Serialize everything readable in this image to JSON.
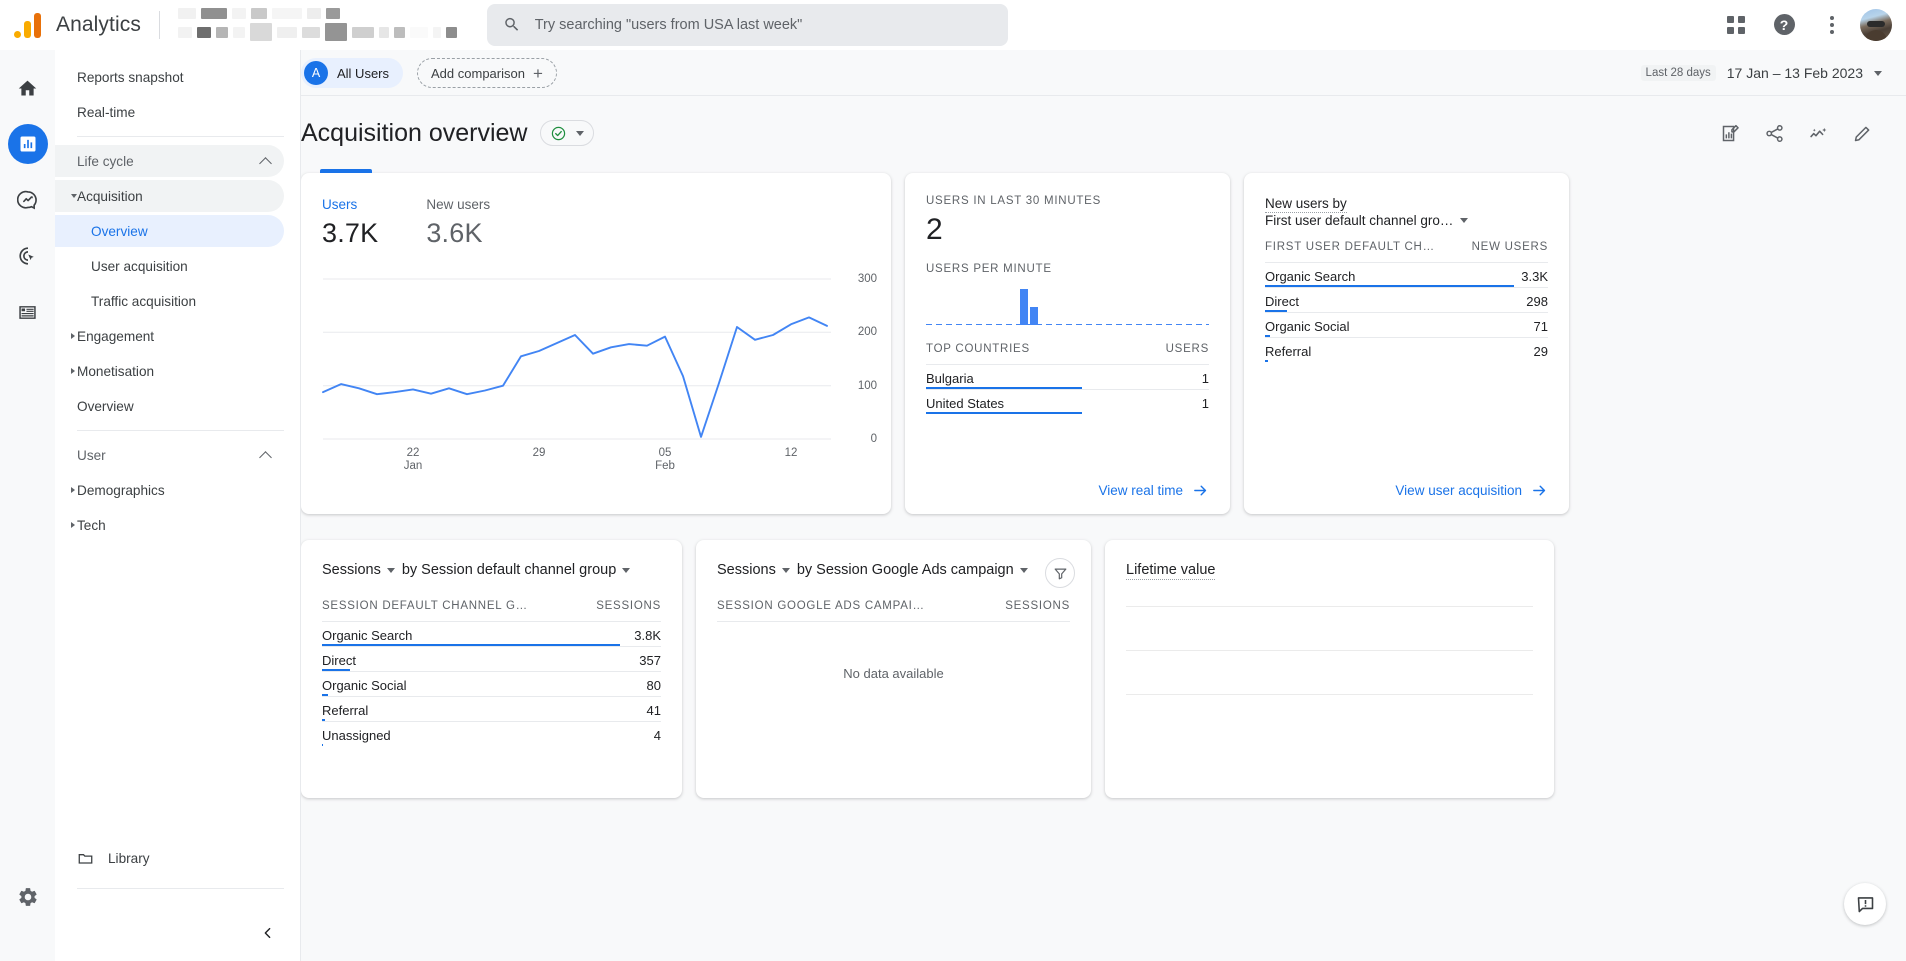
{
  "app": {
    "brand": "Analytics"
  },
  "search": {
    "placeholder": "Try searching \"users from USA last week\""
  },
  "topbar": {
    "apps_label": "Google apps",
    "help_label": "Help",
    "more_label": "More options",
    "account_label": "Account"
  },
  "rail": {
    "items": [
      {
        "name": "home",
        "label": "Home"
      },
      {
        "name": "reports",
        "label": "Reports"
      },
      {
        "name": "explore",
        "label": "Explore"
      },
      {
        "name": "advertising",
        "label": "Advertising"
      },
      {
        "name": "configure",
        "label": "Configure"
      }
    ],
    "settings_label": "Admin"
  },
  "sidebar": {
    "top_items": [
      {
        "label": "Reports snapshot"
      },
      {
        "label": "Real-time"
      }
    ],
    "groups": [
      {
        "label": "Life cycle",
        "items": [
          {
            "label": "Acquisition",
            "expanded": true,
            "highlight": true
          },
          {
            "label": "Overview",
            "sub": true,
            "selected": true
          },
          {
            "label": "User acquisition",
            "sub": true
          },
          {
            "label": "Traffic acquisition",
            "sub": true
          },
          {
            "label": "Engagement",
            "expanded": false
          },
          {
            "label": "Monetisation",
            "expanded": false
          },
          {
            "label": "Overview"
          }
        ]
      },
      {
        "label": "User",
        "items": [
          {
            "label": "Demographics",
            "expanded": false
          },
          {
            "label": "Tech",
            "expanded": false
          }
        ]
      }
    ],
    "library_label": "Library",
    "collapse_label": "Collapse navigation"
  },
  "subheader": {
    "all_users_initial": "A",
    "all_users_label": "All Users",
    "add_comparison_label": "Add comparison",
    "add_comparison_plus": "+",
    "date_badge": "Last 28 days",
    "date_range": "17 Jan – 13 Feb 2023"
  },
  "page": {
    "title": "Acquisition overview",
    "actions": [
      {
        "name": "insights-report-icon",
        "label": "Insights"
      },
      {
        "name": "share-icon",
        "label": "Share this report"
      },
      {
        "name": "sparkle-insights-icon",
        "label": "Insights"
      },
      {
        "name": "edit-pencil-icon",
        "label": "Customise report"
      }
    ]
  },
  "users_card": {
    "tabs": [
      {
        "label": "Users",
        "value": "3.7K",
        "active": true
      },
      {
        "label": "New users",
        "value": "3.6K",
        "active": false
      }
    ]
  },
  "realtime_card": {
    "users_label": "USERS IN LAST 30 MINUTES",
    "users_value": "2",
    "per_minute_label": "USERS PER MINUTE",
    "countries_header": "TOP COUNTRIES",
    "users_header": "USERS",
    "countries": [
      {
        "name": "Bulgaria",
        "value": "1",
        "pct": 100
      },
      {
        "name": "United States",
        "value": "1",
        "pct": 100
      }
    ],
    "footer_link": "View real time"
  },
  "newusers_card": {
    "title_prefix": "New users by",
    "dimension": "First user default channel gro…",
    "col_dimension": "FIRST USER DEFAULT CH…",
    "col_metric": "NEW USERS",
    "rows": [
      {
        "name": "Organic Search",
        "value": "3.3K",
        "pct": 100
      },
      {
        "name": "Direct",
        "value": "298",
        "pct": 9
      },
      {
        "name": "Organic Social",
        "value": "71",
        "pct": 2.2
      },
      {
        "name": "Referral",
        "value": "29",
        "pct": 1
      }
    ],
    "footer_link": "View user acquisition"
  },
  "sessions_channel_card": {
    "metric": "Sessions",
    "by_label": "by Session default channel group",
    "col_dimension": "SESSION DEFAULT CHANNEL G…",
    "col_metric": "SESSIONS",
    "rows": [
      {
        "name": "Organic Search",
        "value": "3.8K",
        "pct": 100
      },
      {
        "name": "Direct",
        "value": "357",
        "pct": 9.4
      },
      {
        "name": "Organic Social",
        "value": "80",
        "pct": 2.1
      },
      {
        "name": "Referral",
        "value": "41",
        "pct": 1.1
      },
      {
        "name": "Unassigned",
        "value": "4",
        "pct": 0.4
      }
    ]
  },
  "sessions_ads_card": {
    "metric": "Sessions",
    "by_label": "by Session Google Ads campaign",
    "col_dimension": "SESSION GOOGLE ADS CAMPAI…",
    "col_metric": "SESSIONS",
    "empty_message": "No data available",
    "filter_label": "Filter"
  },
  "lifetime_card": {
    "title": "Lifetime value"
  },
  "feedback": {
    "label": "Send feedback"
  },
  "colors": {
    "brand_blue": "#1a73e8",
    "chart_blue": "#4285f4",
    "accent_orange": "#f9ab00",
    "accent_orange_dark": "#e8710a",
    "check_green": "#1e8e3e",
    "text_primary": "#202124",
    "text_secondary": "#5f6368",
    "bg_canvas": "#f8f9fa"
  },
  "chart_data": {
    "type": "line",
    "title": "Users",
    "xlabel": "",
    "ylabel": "Users",
    "ylim": [
      0,
      300
    ],
    "yticks": [
      0,
      100,
      200,
      300
    ],
    "grid": true,
    "legend": "none",
    "x_tick_labels": [
      {
        "day": "22",
        "month": "Jan"
      },
      {
        "day": "29",
        "month": ""
      },
      {
        "day": "05",
        "month": "Feb"
      },
      {
        "day": "12",
        "month": ""
      }
    ],
    "x": [
      "17 Jan",
      "18 Jan",
      "19 Jan",
      "20 Jan",
      "21 Jan",
      "22 Jan",
      "23 Jan",
      "24 Jan",
      "25 Jan",
      "26 Jan",
      "27 Jan",
      "28 Jan",
      "29 Jan",
      "30 Jan",
      "31 Jan",
      "01 Feb",
      "02 Feb",
      "03 Feb",
      "04 Feb",
      "05 Feb",
      "06 Feb",
      "07 Feb",
      "08 Feb",
      "09 Feb",
      "10 Feb",
      "11 Feb",
      "12 Feb",
      "13 Feb"
    ],
    "series": [
      {
        "name": "Users",
        "color": "#4285f4",
        "values": [
          88,
          103,
          95,
          84,
          88,
          93,
          85,
          95,
          84,
          91,
          100,
          155,
          165,
          180,
          195,
          160,
          172,
          178,
          175,
          192,
          118,
          4,
          105,
          210,
          186,
          195,
          215,
          228,
          212
        ]
      }
    ]
  },
  "sparkline_data": {
    "type": "bar",
    "title": "Users per minute",
    "bins": 30,
    "values": [
      0,
      0,
      0,
      0,
      0,
      0,
      0,
      0,
      0,
      0,
      2,
      1,
      0,
      0,
      0,
      0,
      0,
      0,
      0,
      0,
      0,
      0,
      0,
      0,
      0,
      0,
      0,
      0,
      0,
      0
    ],
    "ylim": [
      0,
      2
    ]
  }
}
